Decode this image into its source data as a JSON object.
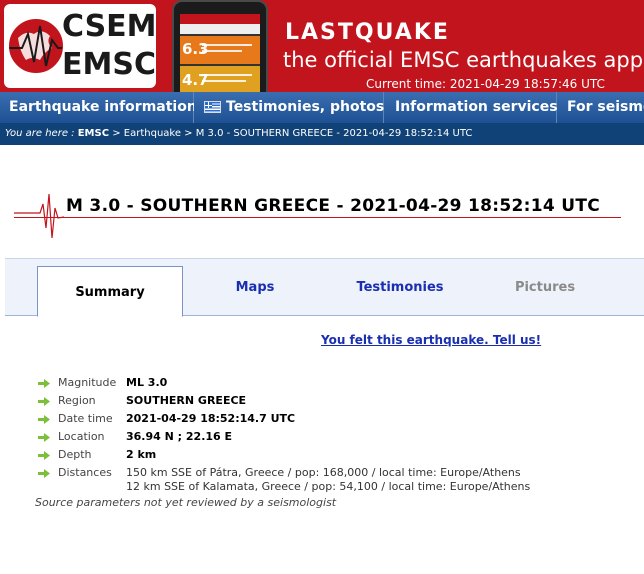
{
  "header": {
    "logo_top": "CSEM",
    "logo_bottom": "EMSC",
    "app_title": "LASTQUAKE",
    "app_subtitle": "the official EMSC earthquakes app",
    "current_time": "Current time: 2021-04-29 18:57:46 UTC",
    "brand_color": "#c2141d"
  },
  "phone": {
    "mag1": "6.3",
    "mag2": "4.7"
  },
  "nav": {
    "items": [
      {
        "label": "Earthquake information"
      },
      {
        "label": "Testimonies, photos"
      },
      {
        "label": "Information services"
      },
      {
        "label": "For seismologists"
      }
    ],
    "color": "#1d5193"
  },
  "breadcrumb": {
    "prefix": "You are here : ",
    "emsc": "EMSC",
    "sep1": " > ",
    "earthquake": "Earthquake",
    "sep2": " > ",
    "current": "M 3.0 - SOUTHERN GREECE - 2021-04-29 18:52:14 UTC"
  },
  "event": {
    "title": "M 3.0 - SOUTHERN GREECE - 2021-04-29 18:52:14 UTC"
  },
  "tabs": [
    {
      "label": "Summary"
    },
    {
      "label": "Maps"
    },
    {
      "label": "Testimonies"
    },
    {
      "label": "Pictures"
    }
  ],
  "felt_link": "You felt this earthquake. Tell us!",
  "params": {
    "magnitude": {
      "label": "Magnitude",
      "value": "ML 3.0"
    },
    "region": {
      "label": "Region",
      "value": "SOUTHERN GREECE"
    },
    "datetime": {
      "label": "Date time",
      "value": "2021-04-29 18:52:14.7 UTC"
    },
    "location": {
      "label": "Location",
      "value": "36.94 N ; 22.16 E"
    },
    "depth": {
      "label": "Depth",
      "value": "2 km"
    },
    "distances": {
      "label": "Distances",
      "line1": "150 km SSE of Pátra, Greece / pop: 168,000 / local time: Europe/Athens",
      "line2": "12 km SSE of Kalamata, Greece / pop: 54,100 / local time: Europe/Athens"
    }
  },
  "source_note": "Source parameters not yet reviewed by a seismologist"
}
